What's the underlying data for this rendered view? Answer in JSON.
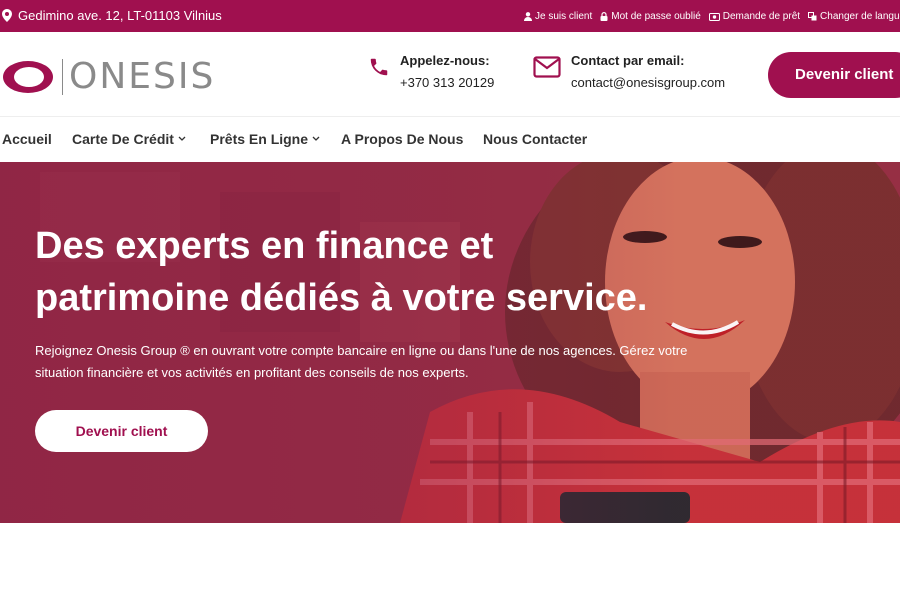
{
  "topbar": {
    "address": "Gedimino ave. 12, LT-01103 Vilnius",
    "links": [
      {
        "label": "Je suis client",
        "icon": "user-icon"
      },
      {
        "label": "Mot de passe oublié",
        "icon": "lock-icon"
      },
      {
        "label": "Demande de prêt",
        "icon": "money-icon"
      },
      {
        "label": "Changer de langue",
        "icon": "translate-icon"
      }
    ]
  },
  "header": {
    "brand": "ONESIS",
    "phone": {
      "label": "Appelez-nous:",
      "value": "+370 313 20129"
    },
    "email": {
      "label": "Contact par email:",
      "value": "contact@onesisgroup.com"
    },
    "cta": "Devenir client"
  },
  "nav": {
    "items": [
      {
        "label": "Accueil"
      },
      {
        "label": "Carte De Crédit"
      },
      {
        "label": "Prêts En Ligne"
      },
      {
        "label": "A Propos De Nous"
      },
      {
        "label": "Nous Contacter"
      }
    ]
  },
  "hero": {
    "title_line1": "Des experts en finance et",
    "title_line2": "patrimoine dédiés à votre service.",
    "description": "Rejoignez Onesis Group ® en ouvrant votre compte bancaire en ligne ou dans l'une de nos agences. Gérez votre situation financière et vos activités en profitant des conseils de nos experts.",
    "cta": "Devenir client"
  },
  "colors": {
    "brand": "#a0104f",
    "logo_gray": "#8a8a8a"
  }
}
